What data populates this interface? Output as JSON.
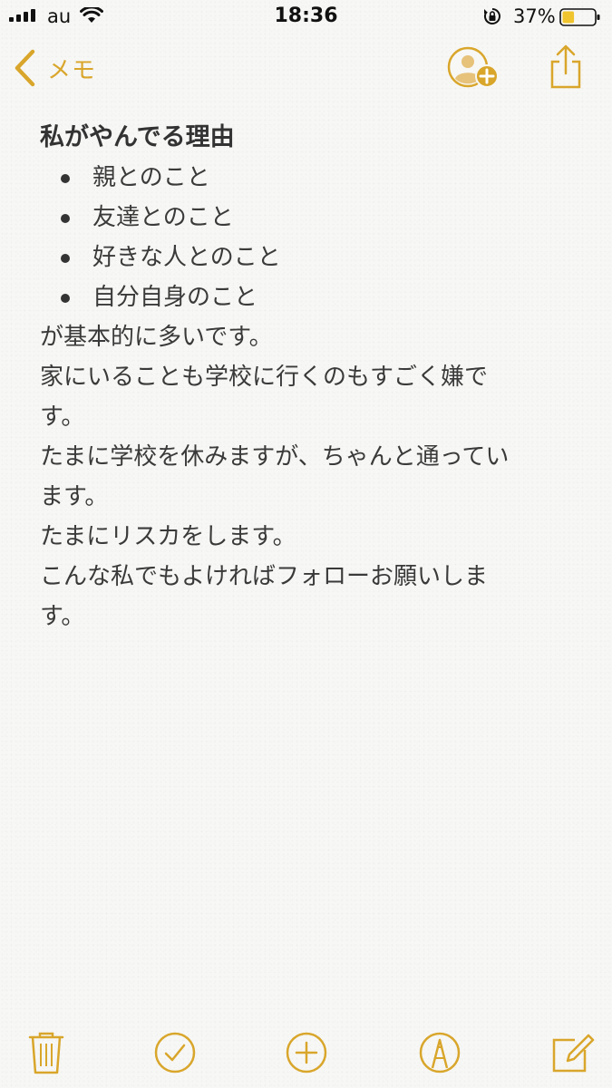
{
  "status_bar": {
    "carrier": "au",
    "time": "18:36",
    "battery_percent": "37%",
    "battery_level": 0.37,
    "icons": [
      "signal-icon",
      "wifi-icon",
      "rotation-lock-icon",
      "battery-icon"
    ]
  },
  "nav": {
    "back_label": "メモ",
    "icons": [
      "chevron-left-icon",
      "add-person-icon",
      "share-icon"
    ]
  },
  "note": {
    "title": "私がやんでる理由",
    "bullets": [
      "親とのこと",
      "友達とのこと",
      "好きな人とのこと",
      "自分自身のこと"
    ],
    "lines": [
      "が基本的に多いです。",
      "家にいることも学校に行くのもすごく嫌で",
      "す。",
      "たまに学校を休みますが、ちゃんと通ってい",
      "ます。",
      "たまにリスカをします。",
      "こんな私でもよければフォローお願いしま",
      "す。"
    ]
  },
  "toolbar": {
    "icons": [
      "trash-icon",
      "checklist-icon",
      "add-icon",
      "sketch-icon",
      "compose-icon"
    ]
  },
  "colors": {
    "accent": "#d9a62b",
    "text": "#3a3a3a",
    "background": "#f7f7f5"
  }
}
